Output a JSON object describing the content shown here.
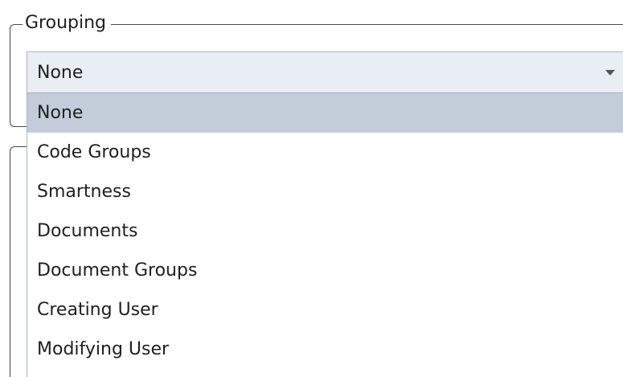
{
  "grouping": {
    "legend": "Grouping",
    "selected_value": "None",
    "options": [
      "None",
      "Code Groups",
      "Smartness",
      "Documents",
      "Document Groups",
      "Creating User",
      "Modifying User"
    ],
    "highlighted_index": 0
  },
  "icons": {
    "combo_arrow": "chevron-down-icon"
  },
  "colors": {
    "combo_background": "#e9eef4",
    "highlight_background": "#c3cdd9",
    "frame_border": "#4a4a4a"
  }
}
